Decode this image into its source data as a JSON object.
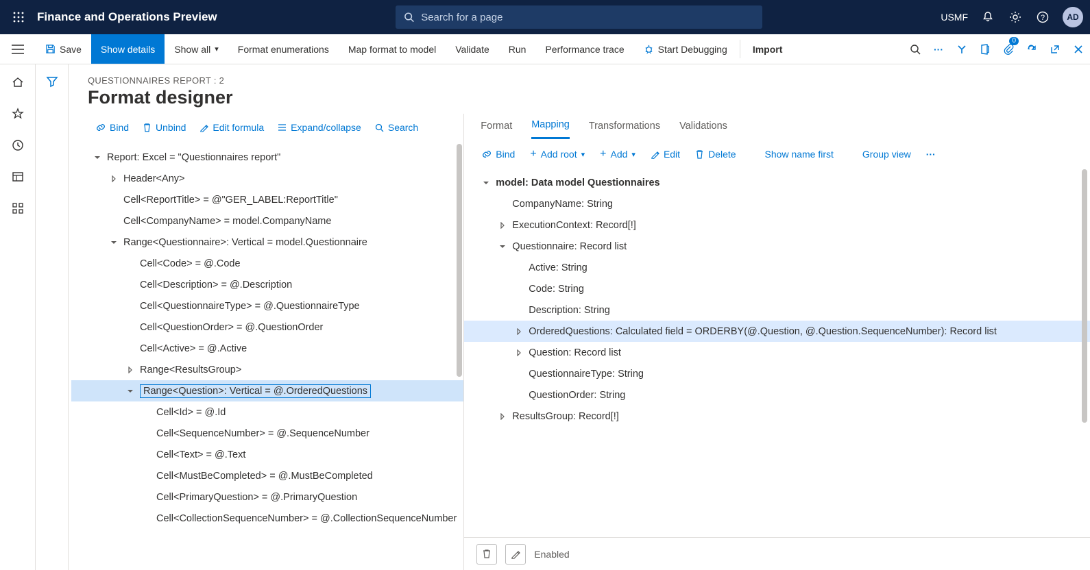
{
  "topbar": {
    "app_title": "Finance and Operations Preview",
    "search_placeholder": "Search for a page",
    "company": "USMF",
    "avatar": "AD"
  },
  "actionbar": {
    "save": "Save",
    "show_details": "Show details",
    "show_all": "Show all",
    "format_enum": "Format enumerations",
    "map_format": "Map format to model",
    "validate": "Validate",
    "run": "Run",
    "perf_trace": "Performance trace",
    "start_debug": "Start Debugging",
    "import": "Import",
    "attach_count": "0"
  },
  "page": {
    "breadcrumb": "QUESTIONNAIRES REPORT : 2",
    "title": "Format designer"
  },
  "left_toolbar": {
    "bind": "Bind",
    "unbind": "Unbind",
    "edit_formula": "Edit formula",
    "expand": "Expand/collapse",
    "search": "Search"
  },
  "left_tree": [
    {
      "d": 0,
      "tw": "down",
      "text": "Report: Excel = \"Questionnaires report\""
    },
    {
      "d": 1,
      "tw": "right",
      "text": "Header<Any>"
    },
    {
      "d": 1,
      "tw": "none",
      "text": "Cell<ReportTitle> = @\"GER_LABEL:ReportTitle\""
    },
    {
      "d": 1,
      "tw": "none",
      "text": "Cell<CompanyName> = model.CompanyName"
    },
    {
      "d": 1,
      "tw": "down",
      "text": "Range<Questionnaire>: Vertical = model.Questionnaire"
    },
    {
      "d": 2,
      "tw": "none",
      "text": "Cell<Code> = @.Code"
    },
    {
      "d": 2,
      "tw": "none",
      "text": "Cell<Description> = @.Description"
    },
    {
      "d": 2,
      "tw": "none",
      "text": "Cell<QuestionnaireType> = @.QuestionnaireType"
    },
    {
      "d": 2,
      "tw": "none",
      "text": "Cell<QuestionOrder> = @.QuestionOrder"
    },
    {
      "d": 2,
      "tw": "none",
      "text": "Cell<Active> = @.Active"
    },
    {
      "d": 2,
      "tw": "right",
      "text": "Range<ResultsGroup>"
    },
    {
      "d": 2,
      "tw": "down",
      "text": "Range<Question>: Vertical = @.OrderedQuestions",
      "selected": true
    },
    {
      "d": 3,
      "tw": "none",
      "text": "Cell<Id> = @.Id"
    },
    {
      "d": 3,
      "tw": "none",
      "text": "Cell<SequenceNumber> = @.SequenceNumber"
    },
    {
      "d": 3,
      "tw": "none",
      "text": "Cell<Text> = @.Text"
    },
    {
      "d": 3,
      "tw": "none",
      "text": "Cell<MustBeCompleted> = @.MustBeCompleted"
    },
    {
      "d": 3,
      "tw": "none",
      "text": "Cell<PrimaryQuestion> = @.PrimaryQuestion"
    },
    {
      "d": 3,
      "tw": "none",
      "text": "Cell<CollectionSequenceNumber> = @.CollectionSequenceNumber"
    }
  ],
  "right_tabs": {
    "format": "Format",
    "mapping": "Mapping",
    "transformations": "Transformations",
    "validations": "Validations"
  },
  "right_toolbar": {
    "bind": "Bind",
    "add_root": "Add root",
    "add": "Add",
    "edit": "Edit",
    "delete": "Delete",
    "show_name_first": "Show name first",
    "group_view": "Group view"
  },
  "right_tree": [
    {
      "d": 0,
      "tw": "down",
      "text": "model: Data model Questionnaires",
      "bold": true
    },
    {
      "d": 1,
      "tw": "none",
      "text": "CompanyName: String"
    },
    {
      "d": 1,
      "tw": "right",
      "text": "ExecutionContext: Record[!]"
    },
    {
      "d": 1,
      "tw": "down",
      "text": "Questionnaire: Record list"
    },
    {
      "d": 2,
      "tw": "none",
      "text": "Active: String"
    },
    {
      "d": 2,
      "tw": "none",
      "text": "Code: String"
    },
    {
      "d": 2,
      "tw": "none",
      "text": "Description: String"
    },
    {
      "d": 2,
      "tw": "right",
      "text": "OrderedQuestions: Calculated field = ORDERBY(@.Question, @.Question.SequenceNumber): Record list",
      "sel2": true
    },
    {
      "d": 2,
      "tw": "right",
      "text": "Question: Record list"
    },
    {
      "d": 2,
      "tw": "none",
      "text": "QuestionnaireType: String"
    },
    {
      "d": 2,
      "tw": "none",
      "text": "QuestionOrder: String"
    },
    {
      "d": 1,
      "tw": "right",
      "text": "ResultsGroup: Record[!]"
    }
  ],
  "bottom": {
    "enabled": "Enabled"
  }
}
